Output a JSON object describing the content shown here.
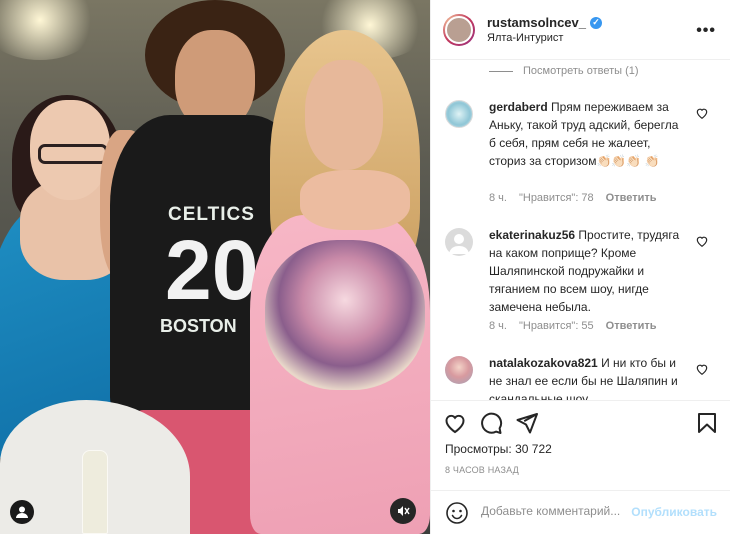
{
  "post": {
    "username": "rustamsolncev_",
    "location": "Ялта-Интурист",
    "verified": true
  },
  "media": {
    "jersey_team": "CELTICS",
    "jersey_number": "20",
    "jersey_city": "BOSTON"
  },
  "comments": {
    "view_replies": "Посмотреть ответы (1)",
    "items": [
      {
        "username": "gerdaberd",
        "text": "Прям переживаем за Аньку, такой труд адский, берегла б себя, прям себя не жалеет, сториз за сторизом👏🏻👏🏻👏🏻 👏🏻",
        "age": "8 ч.",
        "likes": "\"Нравится\": 78",
        "reply": "Ответить"
      },
      {
        "username": "ekaterinakuz56",
        "text": "Простите, трудяга на каком поприще? Кроме Шаляпинской подружайки и тяганием по всем шоу, нигде замечена небыла.",
        "age": "8 ч.",
        "likes": "\"Нравится\": 55",
        "reply": "Ответить"
      },
      {
        "username": "natalakozakova821",
        "text": "И ни кто бы и не знал ее если бы не Шаляпин и скандальные шоу",
        "age": "",
        "likes": "",
        "reply": ""
      }
    ]
  },
  "stats": {
    "views_label": "Просмотры:",
    "views_value": "30 722",
    "time_ago": "8 часов назад"
  },
  "composer": {
    "placeholder": "Добавьте комментарий...",
    "publish_label": "Опубликовать"
  },
  "icons": {
    "like": "heart-icon",
    "comment": "comment-icon",
    "share": "share-icon",
    "save": "bookmark-icon",
    "more": "more-icon",
    "emoji": "emoji-icon",
    "mute": "mute-icon"
  },
  "colors": {
    "verified": "#3897f0",
    "publish_disabled": "#b2dffc",
    "meta_text": "#8e8e8e"
  }
}
